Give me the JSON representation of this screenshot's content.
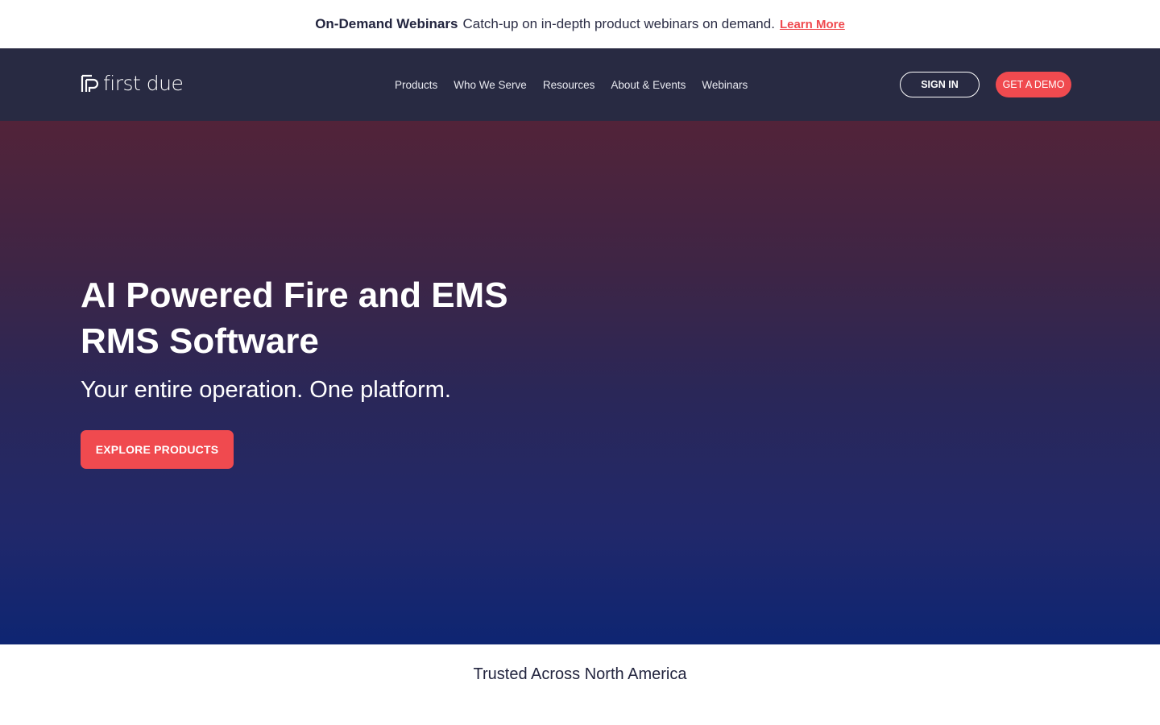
{
  "announcement": {
    "title": "On-Demand Webinars",
    "text": "Catch-up on in-depth product webinars on demand.",
    "link_label": "Learn More"
  },
  "nav": {
    "logo_text": "first due",
    "items": [
      {
        "label": "Products"
      },
      {
        "label": "Who We Serve"
      },
      {
        "label": "Resources"
      },
      {
        "label": "About & Events"
      },
      {
        "label": "Webinars"
      }
    ],
    "sign_in_label": "SIGN IN",
    "demo_label": "GET A DEMO"
  },
  "hero": {
    "title": "AI Powered Fire and EMS RMS Software",
    "subtitle": "Your entire operation. One platform.",
    "cta_label": "EXPLORE PRODUCTS"
  },
  "trusted": {
    "title": "Trusted Across North America"
  },
  "colors": {
    "accent": "#f04a4f",
    "nav_bg": "#282a42",
    "hero_top": "#522339",
    "hero_bottom": "#0e2572"
  }
}
